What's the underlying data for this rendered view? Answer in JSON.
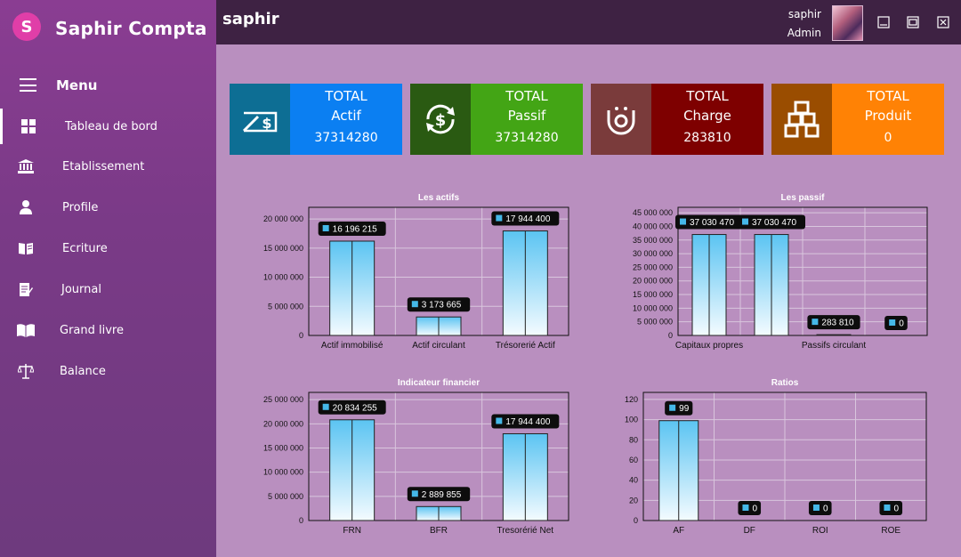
{
  "brand": {
    "title": "Saphir Compta",
    "logo_letter": "S"
  },
  "menu": {
    "label": "Menu",
    "items": [
      {
        "label": "Tableau de bord",
        "icon": "dashboard-icon"
      },
      {
        "label": "Etablissement",
        "icon": "bank-icon"
      },
      {
        "label": "Profile",
        "icon": "user-icon"
      },
      {
        "label": "Ecriture",
        "icon": "book-open-icon"
      },
      {
        "label": "Journal",
        "icon": "journal-icon"
      },
      {
        "label": "Grand livre",
        "icon": "book-icon"
      },
      {
        "label": "Balance",
        "icon": "scale-icon"
      }
    ]
  },
  "topbar": {
    "app_name": "saphir",
    "user_name": "saphir",
    "user_role": "Admin"
  },
  "cards": [
    {
      "line1": "TOTAL",
      "line2": "Actif",
      "value": "37314280",
      "icon": "cheque-icon",
      "icon_bg": "#0d6e94",
      "bg": "#0b7ff2"
    },
    {
      "line1": "TOTAL",
      "line2": "Passif",
      "value": "37314280",
      "icon": "dollar-cycle-icon",
      "icon_bg": "#2a5a12",
      "bg": "#43a515"
    },
    {
      "line1": "TOTAL",
      "line2": "Charge",
      "value": "283810",
      "icon": "charge-icon",
      "icon_bg": "#7a3b3b",
      "bg": "#7e0000"
    },
    {
      "line1": "TOTAL",
      "line2": "Produit",
      "value": "0",
      "icon": "boxes-icon",
      "icon_bg": "#9a4d00",
      "bg": "#ff8205"
    }
  ],
  "chart_data": [
    {
      "type": "bar",
      "title": "Les actifs",
      "categories": [
        "Actif immobilisé",
        "Actif circulant",
        "Trésorerié Actif"
      ],
      "values": [
        16196215,
        3173665,
        17944400
      ],
      "labels": [
        "16 196 215",
        "3 173 665",
        "17 944 400"
      ],
      "ylim": [
        0,
        22000000
      ],
      "yticks": [
        0,
        5000000,
        10000000,
        15000000,
        20000000
      ],
      "ytick_labels": [
        "0",
        "5 000 000",
        "10 000 000",
        "15 000 000",
        "20 000 000"
      ],
      "grid": true
    },
    {
      "type": "bar",
      "title": "Les passif",
      "categories": [
        "Capitaux propres",
        "",
        "Passifs circulant",
        ""
      ],
      "values": [
        37030470,
        37030470,
        283810,
        0
      ],
      "labels": [
        "37 030 470",
        "37 030 470",
        "283 810",
        "0"
      ],
      "ylim": [
        0,
        47000000
      ],
      "yticks": [
        0,
        5000000,
        10000000,
        15000000,
        20000000,
        25000000,
        30000000,
        35000000,
        40000000,
        45000000
      ],
      "ytick_labels": [
        "0",
        "5 000 000",
        "10 000 000",
        "15 000 000",
        "20 000 000",
        "25 000 000",
        "30 000 000",
        "35 000 000",
        "40 000 000",
        "45 000 000"
      ],
      "grid": true
    },
    {
      "type": "bar",
      "title": "Indicateur financier",
      "categories": [
        "FRN",
        "BFR",
        "Tresorérié Net"
      ],
      "values": [
        20834255,
        2889855,
        17944400
      ],
      "labels": [
        "20 834 255",
        "2 889 855",
        "17 944 400"
      ],
      "ylim": [
        0,
        26500000
      ],
      "yticks": [
        0,
        5000000,
        10000000,
        15000000,
        20000000,
        25000000
      ],
      "ytick_labels": [
        "0",
        "5 000 000",
        "10 000 000",
        "15 000 000",
        "20 000 000",
        "25 000 000"
      ],
      "grid": true
    },
    {
      "type": "bar",
      "title": "Ratios",
      "categories": [
        "AF",
        "DF",
        "ROI",
        "ROE"
      ],
      "values": [
        99,
        0,
        0,
        0
      ],
      "labels": [
        "99",
        "0",
        "0",
        "0"
      ],
      "ylim": [
        0,
        127
      ],
      "yticks": [
        0,
        20,
        40,
        60,
        80,
        100,
        120
      ],
      "ytick_labels": [
        "0",
        "20",
        "40",
        "60",
        "80",
        "100",
        "120"
      ],
      "grid": true
    }
  ]
}
